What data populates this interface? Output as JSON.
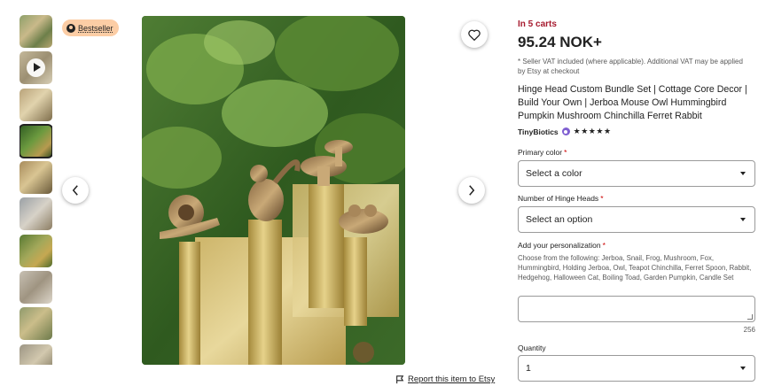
{
  "gallery": {
    "thumbnails": [
      "thumb-1",
      "thumb-video",
      "thumb-3",
      "thumb-4",
      "thumb-5",
      "thumb-6",
      "thumb-7",
      "thumb-8",
      "thumb-9",
      "thumb-10"
    ],
    "selected_index": 3
  },
  "badge": {
    "label": "Bestseller",
    "icon": "award-icon"
  },
  "report": {
    "label": "Report this item to Etsy",
    "icon": "flag-icon"
  },
  "listing": {
    "in_carts": "In 5 carts",
    "price": "95.24 NOK+",
    "vat_note": "* Seller VAT included (where applicable). Additional VAT may be applied by Etsy at checkout",
    "title": "Hinge Head Custom Bundle Set | Cottage Core Decor | Build Your Own | Jerboa Mouse Owl Hummingbird Pumpkin Mushroom Chinchilla Ferret Rabbit",
    "seller": "TinyBiotics",
    "rating_stars": "★★★★★",
    "rating_value": 5
  },
  "options": {
    "primary_color_label": "Primary color",
    "primary_color_value": "Select a color",
    "hinge_heads_label": "Number of Hinge Heads",
    "hinge_heads_value": "Select an option",
    "required_mark": "*"
  },
  "personalization": {
    "label": "Add your personalization",
    "helper": "Choose from the following: Jerboa, Snail, Frog, Mushroom, Fox, Hummingbird, Holding Jerboa, Owl, Teapot Chinchilla, Ferret Spoon, Rabbit, Hedgehog, Halloween Cat, Boiling Toad, Garden Pumpkin, Candle Set",
    "value": "",
    "char_count": "256"
  },
  "quantity": {
    "label": "Quantity",
    "value": "1"
  },
  "colors": {
    "in_carts": "#a61a2e",
    "badge_bg": "#fccda5",
    "star_seller": "#7f5fd1"
  }
}
